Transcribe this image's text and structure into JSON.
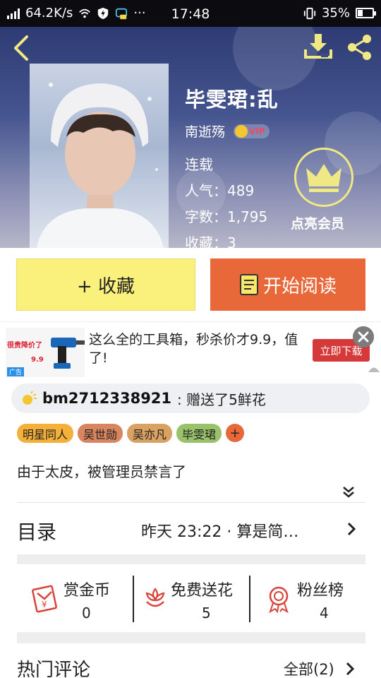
{
  "status_bar": {
    "net_speed": "64.2K/s",
    "time": "17:48",
    "battery": "35%",
    "battery_level": 0.35,
    "notification_dots": "···"
  },
  "book": {
    "title": "毕雯珺:乱",
    "author": "南逝殇",
    "vip_label": "VIP",
    "status": "连载",
    "popularity_label": "人气：",
    "popularity": "489",
    "word_count_label": "字数：",
    "word_count": "1,795",
    "favorites_label": "收藏：",
    "favorites": "3",
    "member_label": "点亮会员"
  },
  "actions": {
    "collect_label": "+ 收藏",
    "read_label": "开始阅读"
  },
  "ad": {
    "text": "这么全的工具箱，秒杀价才9.9，值了!",
    "download_label": "立即下载",
    "image_caption": "很贵降价了",
    "image_price": "9.9",
    "image_tag": "广告"
  },
  "gift": {
    "user": "bm2712338921",
    "text": ": 赠送了5鲜花"
  },
  "tags": [
    {
      "label": "明星同人",
      "color": "#f5b03a"
    },
    {
      "label": "吴世勋",
      "color": "#d9855f"
    },
    {
      "label": "吴亦凡",
      "color": "#d9a262"
    },
    {
      "label": "毕雯珺",
      "color": "#9ac26a"
    }
  ],
  "tag_add": "+",
  "description": "由于太皮，被管理员禁言了",
  "toc": {
    "title": "目录",
    "latest": "昨天 23:22 · 算是简…"
  },
  "stats": [
    {
      "label": "赏金币",
      "count": "0"
    },
    {
      "label": "免费送花",
      "count": "5"
    },
    {
      "label": "粉丝榜",
      "count": "4"
    }
  ],
  "comments": {
    "title": "热门评论",
    "all_label": "全部(2)"
  },
  "colors": {
    "accent_orange": "#e9683a",
    "accent_yellow": "#faf17c",
    "icon_yellow": "#f0e884",
    "icon_red": "#d8433a"
  }
}
